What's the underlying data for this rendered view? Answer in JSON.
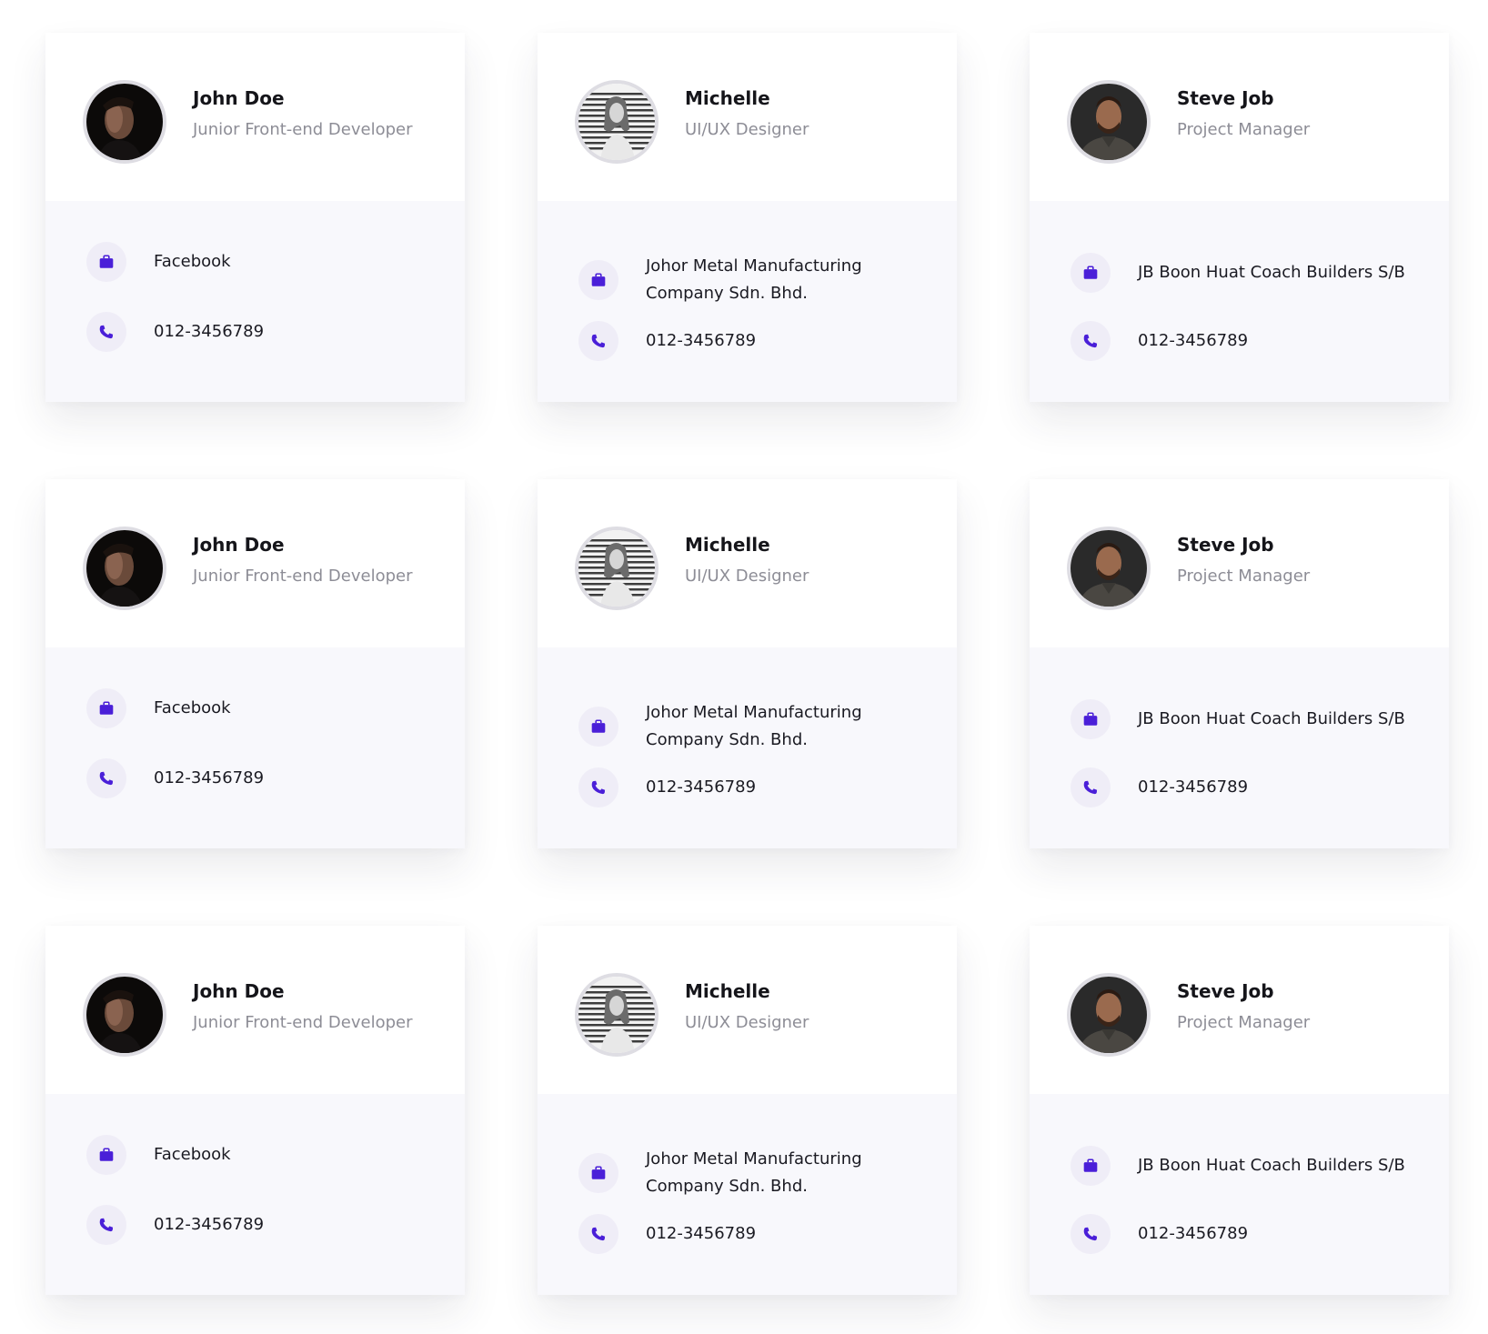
{
  "colors": {
    "accent": "#4a1fd8",
    "icon_bg": "#efedf7",
    "card_bottom_bg": "#f8f8fc"
  },
  "cards": [
    {
      "name": "John Doe",
      "role": "Junior Front-end Developer",
      "company": "Facebook",
      "phone": "012-3456789",
      "avatar": "dark-portrait-man"
    },
    {
      "name": "Michelle",
      "role": "UI/UX Designer",
      "company": "Johor Metal Manufacturing Company Sdn. Bhd.",
      "phone": "012-3456789",
      "avatar": "grayscale-portrait-woman"
    },
    {
      "name": "Steve Job",
      "role": "Project Manager",
      "company": "JB Boon Huat Coach Builders S/B",
      "phone": "012-3456789",
      "avatar": "portrait-man-beard"
    },
    {
      "name": "John Doe",
      "role": "Junior Front-end Developer",
      "company": "Facebook",
      "phone": "012-3456789",
      "avatar": "dark-portrait-man"
    },
    {
      "name": "Michelle",
      "role": "UI/UX Designer",
      "company": "Johor Metal Manufacturing Company Sdn. Bhd.",
      "phone": "012-3456789",
      "avatar": "grayscale-portrait-woman"
    },
    {
      "name": "Steve Job",
      "role": "Project Manager",
      "company": "JB Boon Huat Coach Builders S/B",
      "phone": "012-3456789",
      "avatar": "portrait-man-beard"
    },
    {
      "name": "John Doe",
      "role": "Junior Front-end Developer",
      "company": "Facebook",
      "phone": "012-3456789",
      "avatar": "dark-portrait-man"
    },
    {
      "name": "Michelle",
      "role": "UI/UX Designer",
      "company": "Johor Metal Manufacturing Company Sdn. Bhd.",
      "phone": "012-3456789",
      "avatar": "grayscale-portrait-woman"
    },
    {
      "name": "Steve Job",
      "role": "Project Manager",
      "company": "JB Boon Huat Coach Builders S/B",
      "phone": "012-3456789",
      "avatar": "portrait-man-beard"
    }
  ],
  "icons": {
    "company": "briefcase-icon",
    "phone": "phone-icon"
  }
}
